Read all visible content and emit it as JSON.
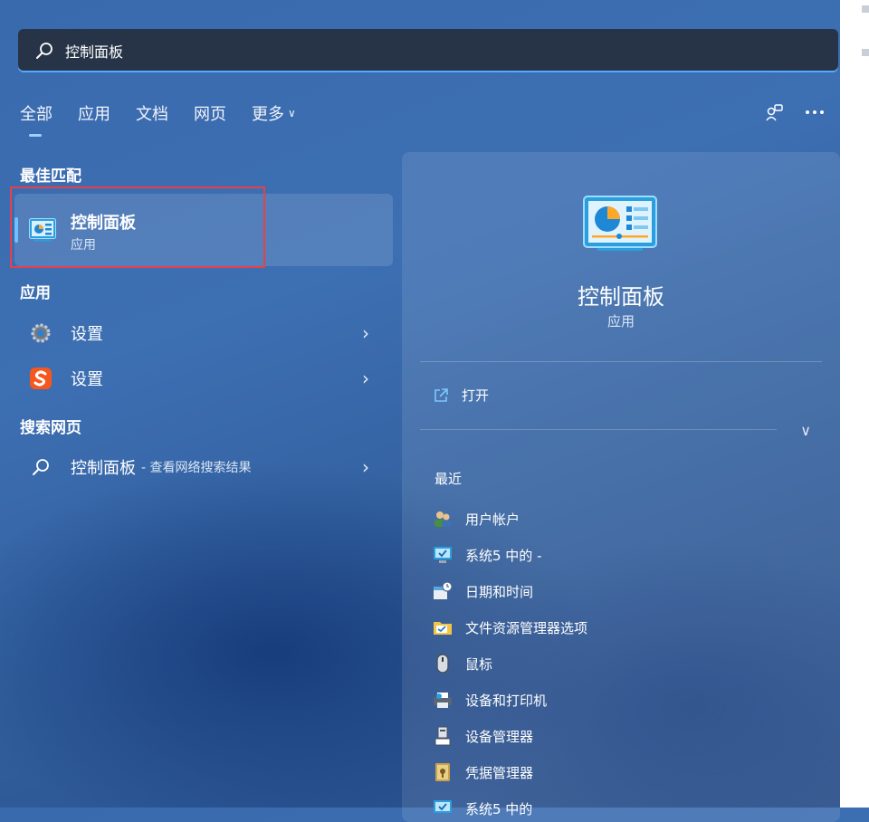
{
  "search": {
    "query": "控制面板"
  },
  "tabs": [
    {
      "label": "全部"
    },
    {
      "label": "应用"
    },
    {
      "label": "文档"
    },
    {
      "label": "网页"
    },
    {
      "label": "更多"
    }
  ],
  "sections": {
    "best_match": "最佳匹配",
    "apps": "应用",
    "web": "搜索网页"
  },
  "best_match": {
    "name": "控制面板",
    "type": "应用"
  },
  "apps": [
    {
      "label": "设置",
      "icon": "gear-icon"
    },
    {
      "label": "设置",
      "icon": "sogou-icon"
    }
  ],
  "web_result": {
    "query": "控制面板",
    "suffix": "- 查看网络搜索结果"
  },
  "detail": {
    "name": "控制面板",
    "type": "应用",
    "open_label": "打开",
    "recent_title": "最近",
    "recent": [
      {
        "label": "用户帐户",
        "icon": "user-accounts-icon"
      },
      {
        "label": "系统5 中的 -",
        "icon": "system-icon"
      },
      {
        "label": "日期和时间",
        "icon": "date-time-icon"
      },
      {
        "label": "文件资源管理器选项",
        "icon": "folder-options-icon"
      },
      {
        "label": "鼠标",
        "icon": "mouse-icon"
      },
      {
        "label": "设备和打印机",
        "icon": "printer-icon"
      },
      {
        "label": "设备管理器",
        "icon": "device-manager-icon"
      },
      {
        "label": "凭据管理器",
        "icon": "credential-icon"
      },
      {
        "label": "系统5 中的",
        "icon": "system-icon"
      }
    ]
  },
  "colors": {
    "accent": "#6cc2ff",
    "highlight": "#e8404a",
    "search_bg": "#273447"
  }
}
